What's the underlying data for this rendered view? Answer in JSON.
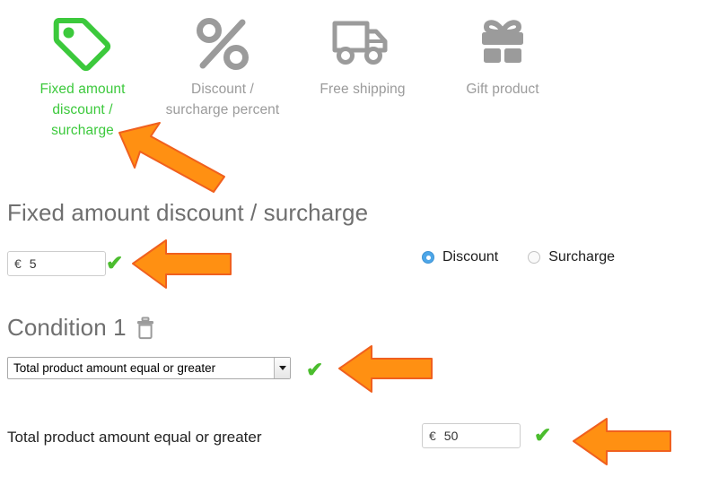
{
  "type_selector": {
    "items": [
      {
        "icon": "tag-icon",
        "label": "Fixed amount discount / surcharge",
        "active": true,
        "color": "#3cc93c"
      },
      {
        "icon": "percent-icon",
        "label": "Discount / surcharge percent",
        "active": false,
        "color": "#9b9b9b"
      },
      {
        "icon": "truck-icon",
        "label": "Free shipping",
        "active": false,
        "color": "#9b9b9b"
      },
      {
        "icon": "gift-icon",
        "label": "Gift product",
        "active": false,
        "color": "#9b9b9b"
      }
    ]
  },
  "fixed_amount_section": {
    "title": "Fixed amount discount / surcharge",
    "amount": {
      "currency": "€",
      "value": "5",
      "valid_icon": "✔"
    },
    "mode": {
      "options": [
        {
          "label": "Discount",
          "selected": true
        },
        {
          "label": "Surcharge",
          "selected": false
        }
      ]
    }
  },
  "condition_section": {
    "title": "Condition 1",
    "delete_icon": "trash-icon",
    "select": {
      "value": "Total product amount equal or greater",
      "arrow_icon": "chevron-down-icon",
      "valid_icon": "✔"
    },
    "value_row": {
      "label": "Total product amount equal or greater",
      "currency": "€",
      "value": "50",
      "valid_icon": "✔"
    }
  },
  "annotations": {
    "arrow_color": "#FF9012",
    "arrow_outline": "#F05A28",
    "arrows": [
      {
        "name": "arrow-to-fixed-amount-tab",
        "points_to": "Fixed amount discount / surcharge tab"
      },
      {
        "name": "arrow-to-amount-input",
        "points_to": "amount input field"
      },
      {
        "name": "arrow-to-condition-select",
        "points_to": "condition type select"
      },
      {
        "name": "arrow-to-condition-value",
        "points_to": "condition value input"
      }
    ]
  },
  "colors": {
    "accent_green": "#3cc93c",
    "check_green": "#4bbd2e",
    "muted_gray": "#9b9b9b",
    "heading_gray": "#6f6f6f",
    "radio_blue": "#4da6e8"
  }
}
